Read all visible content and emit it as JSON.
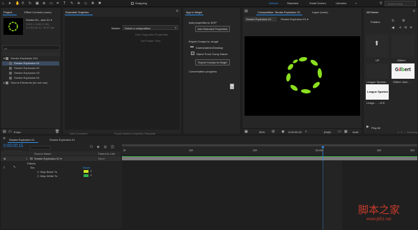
{
  "menubar": {
    "left_items": [
      "Snapping"
    ],
    "workspaces": [
      "Default",
      "Standard",
      "Small Screen",
      "Libraries"
    ],
    "search_placeholder": "Search Help"
  },
  "project_panel": {
    "tabs": [
      "Project",
      "Effect Controls (none)"
    ],
    "preview_name": "Smoke Ex...sion 01 ▾",
    "preview_meta": [
      "1920 x 1080 (1.00)",
      "Δ 0;00;05;12, 29.97 fps"
    ],
    "search_placeholder": "ρ▾",
    "items": [
      {
        "label": "Smoke Explosion 204",
        "indent": 0,
        "selected": false
      },
      {
        "label": "Smoke Explosion 01",
        "indent": 1,
        "selected": true
      },
      {
        "label": "Smoke Explosion 02",
        "indent": 1,
        "selected": false
      },
      {
        "label": "Smoke Explosion 03",
        "indent": 1,
        "selected": false
      },
      {
        "label": "Smoke Explosion 04",
        "indent": 1,
        "selected": false
      },
      {
        "label": "Source Elements (do not use)",
        "indent": 0,
        "selected": false
      }
    ],
    "bpc": "8 bpc"
  },
  "essential_graphics": {
    "tab": "Essential Graphics",
    "master_label": "Master:",
    "master_value": "Select a composition",
    "solo_button": "Solo Supported Properties",
    "set_poster_button": "Set Poster Time",
    "add_comment": "Add Comment",
    "export_button": "Export Motion Graphics Template"
  },
  "app_panel": {
    "tab": "App to Mogrt",
    "add_props_label": "Add properties to EGP",
    "add_props_button": "Add Selected Properties",
    "export_label": "Export Comps to .mogrt",
    "path": "/Users/admin/Desktop",
    "name_from_comp": "Name From Comp Name",
    "export_button": "Export Comps to Mogrt",
    "progress_label": "Conversation progress",
    "progress_value": "1"
  },
  "composition": {
    "tabs": [
      "Composition: Smoke Explosion 01",
      "Layer (none)"
    ],
    "subtabs": [
      "Smoke Explosion 01",
      "Smoke Explosion 01 ▾"
    ],
    "zoom": "50%",
    "time": "0:00:00:15",
    "quality": "(Half)",
    "extra": "Activ"
  },
  "aeviewer": {
    "tab": "AEViewer",
    "folders_label": "Folders",
    "items": [
      {
        "label": "UP",
        "kind": "up"
      },
      {
        "label": "Gilbert",
        "kind": "folder"
      },
      {
        "label": "League Spartan",
        "kind": "folder"
      },
      {
        "label": "Gilbert Jack ...",
        "kind": "logo-gilbert"
      },
      {
        "label": "League Spartan",
        "kind": "logo-league"
      },
      {
        "label": "Leagu... ...JCK",
        "kind": "logo-league-dark"
      }
    ],
    "play_all": "Play All",
    "status": "1 / 4 ↔ Showing"
  },
  "timeline": {
    "tabs": [
      "Smoke Explosion 01",
      "Smoke Explosion 01"
    ],
    "timecode": "0:00:00:15",
    "frames": "00015 (29.97 fps)",
    "columns": [
      "Source Name",
      "Parent & Link"
    ],
    "layers": [
      {
        "num": "1",
        "name": "Smoke Explosion 01 ▾",
        "parent": "None"
      }
    ],
    "sub_rows": [
      {
        "label": "Effects",
        "value": ""
      },
      {
        "label": "Tint",
        "value": "Reset"
      },
      {
        "label": "Map Black To",
        "value": ""
      },
      {
        "label": "Map White To",
        "value": ""
      }
    ],
    "ruler_labels": [
      "0f",
      "10f",
      "20f",
      "01:00f",
      "10f",
      "20f"
    ]
  },
  "watermark": {
    "main": "脚本之家",
    "url": "www.jb51.net"
  },
  "colors": {
    "accent": "#2d8ceb",
    "ring": "#8bdf1f",
    "track": "#2f9e43"
  }
}
